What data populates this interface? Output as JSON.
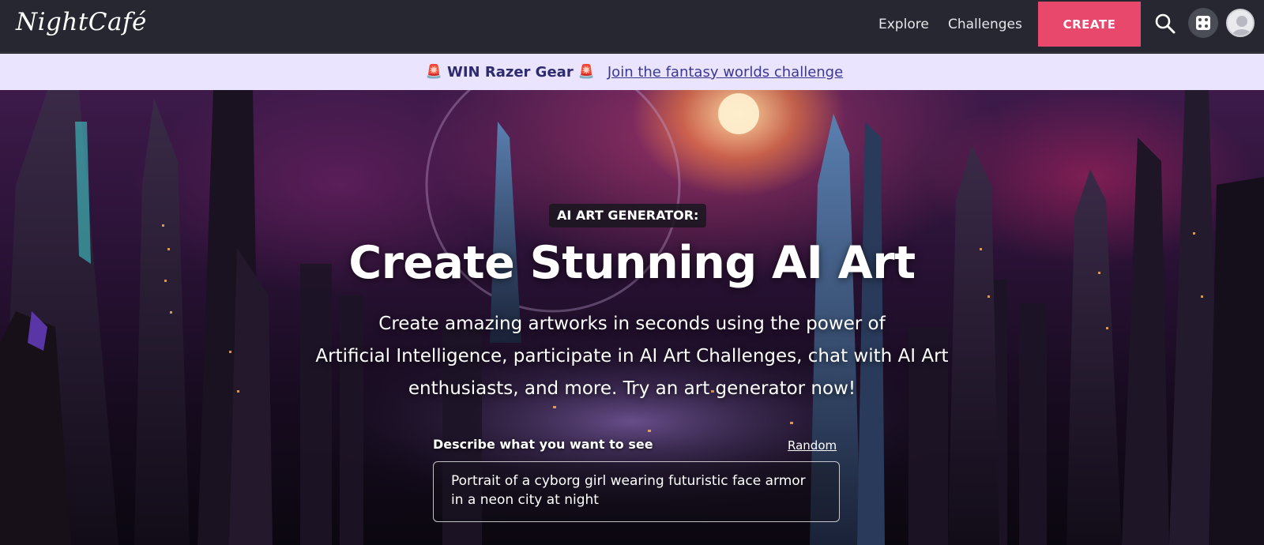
{
  "nav": {
    "logo": "NightCafé",
    "links": [
      "Explore",
      "Challenges"
    ],
    "create_label": "CREATE",
    "accent": "#e8486c",
    "icons": [
      "search-icon",
      "dice-icon",
      "avatar"
    ]
  },
  "banner": {
    "strong": "WIN Razer Gear",
    "link": "Join the fantasy worlds challenge",
    "icon": "siren-emoji",
    "siren": "🚨"
  },
  "hero": {
    "tag": "AI ART GENERATOR:",
    "title": "Create Stunning AI Art",
    "subtitle_lines": [
      "Create amazing artworks in seconds using the power of",
      "Artificial Intelligence, participate in AI Art Challenges, chat with AI Art",
      "enthusiasts, and more. Try an art generator now!"
    ],
    "prompt_label": "Describe what you want to see",
    "random_label": "Random",
    "prompt_value": "Portrait of a cyborg girl wearing futuristic face armor in a neon city at night"
  }
}
